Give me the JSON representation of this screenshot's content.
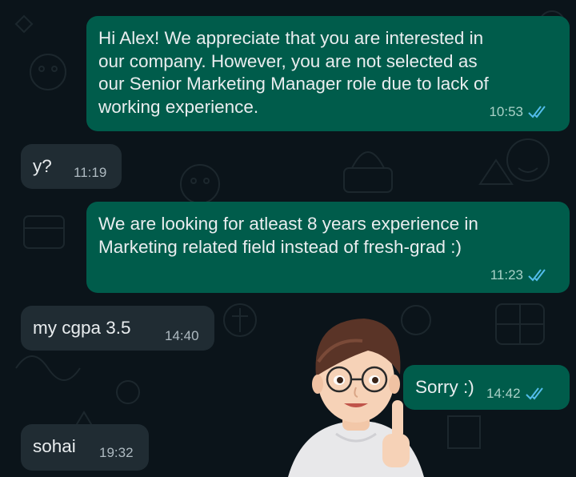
{
  "chat": {
    "messages": [
      {
        "direction": "outgoing",
        "text": "Hi Alex! We appreciate that you are interested in\nour company. However, you are not selected as\nour Senior Marketing Manager role due to lack of\nworking experience.",
        "time": "10:53",
        "status": "read"
      },
      {
        "direction": "incoming",
        "text": "y?",
        "time": "11:19"
      },
      {
        "direction": "outgoing",
        "text": "We are looking for atleast 8 years experience in\nMarketing related field instead of fresh-grad :)",
        "time": "11:23",
        "status": "read"
      },
      {
        "direction": "incoming",
        "text": "my cgpa 3.5",
        "time": "14:40"
      },
      {
        "direction": "outgoing",
        "text": "Sorry :)",
        "time": "14:42",
        "status": "read"
      },
      {
        "direction": "incoming",
        "text": "sohai",
        "time": "19:32"
      }
    ]
  },
  "colors": {
    "background": "#0b141a",
    "outgoing_bubble": "#005c4b",
    "incoming_bubble": "#202c33",
    "read_ticks": "#53bdeb"
  },
  "icons": [
    "double-check-icon",
    "avatar-sticker"
  ]
}
